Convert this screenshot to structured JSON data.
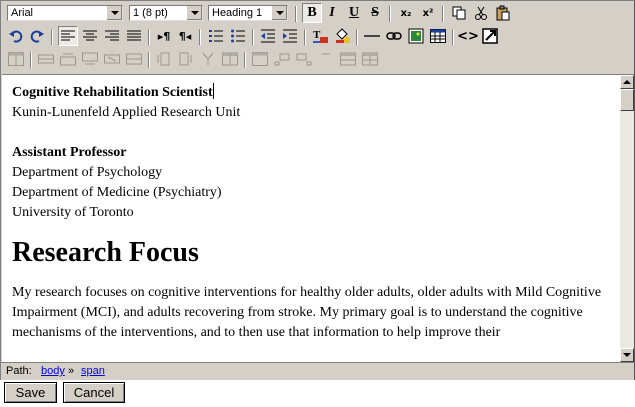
{
  "toolbar": {
    "font_family": "Arial",
    "font_size": "1 (8 pt)",
    "block_format": "Heading 1",
    "buttons": {
      "bold": "B",
      "italic": "I",
      "underline": "U",
      "strikethrough": "S",
      "subscript": "x₂",
      "superscript": "x²"
    }
  },
  "document": {
    "line1": "Cognitive Rehabilitation Scientist",
    "line2": "Kunin-Lunenfeld Applied Research Unit",
    "line3": "Assistant Professor",
    "line4": "Department of Psychology",
    "line5": "Department of Medicine (Psychiatry)",
    "line6": "University of Toronto",
    "heading": "Research Focus",
    "paragraph": "My research focuses on cognitive interventions for healthy older adults, older adults with Mild Cognitive Impairment (MCI), and adults recovering from stroke. My primary goal is to understand the cognitive mechanisms of the interventions, and to then use that information to help improve their"
  },
  "statusbar": {
    "label": "Path:",
    "path_body": "body",
    "separator": "»",
    "path_span": "span"
  },
  "actions": {
    "save": "Save",
    "cancel": "Cancel"
  },
  "scrollbar": {
    "position": 0.0
  }
}
